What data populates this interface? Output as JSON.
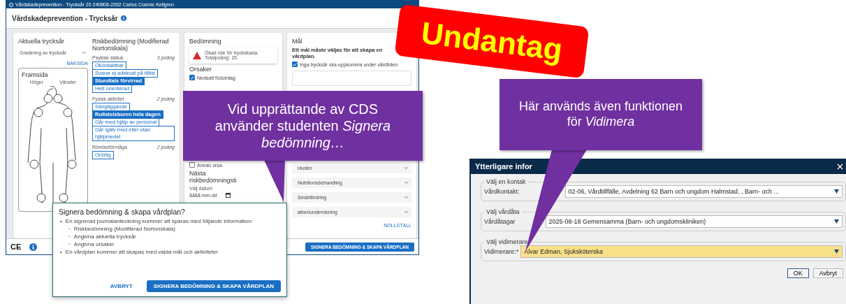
{
  "left_window": {
    "title": "Vårdskadeprevention - Trycksår 20 240806-2392 Carlos Cosmic Kellgren",
    "header": "Vårdskadeprevention - Trycksår",
    "current": {
      "title": "Aktuella trycksår",
      "dropdown": "Gradering av trycksår",
      "link": "BAKSIDA",
      "figure_title": "Framsida",
      "right_label": "Höger",
      "left_label": "Vänster"
    },
    "risk": {
      "title": "Riskbedömning (Modifierad Nortonskala)",
      "groups": [
        {
          "label": "Psykisk status",
          "points": "3 poäng",
          "options": [
            {
              "label": "Okontaktbar",
              "selected": false
            },
            {
              "label": "Svarar ej adekvat på tilltal",
              "selected": false
            },
            {
              "label": "Stundtals förvirrad",
              "selected": true
            },
            {
              "label": "Helt orienterad",
              "selected": false
            }
          ]
        },
        {
          "label": "Fysisk aktivitet",
          "points": "2 poäng",
          "options": [
            {
              "label": "Sängliggande",
              "selected": false
            },
            {
              "label": "Rullstolsburen hela dagen",
              "selected": true
            },
            {
              "label": "Går med hjälp av personal",
              "selected": false
            },
            {
              "label": "Går själv med eller utan hjälpmedel",
              "selected": false
            }
          ]
        },
        {
          "label": "Rörelseförmåga",
          "points": "2 poäng",
          "options": [
            {
              "label": "Orörlig",
              "selected": false
            }
          ]
        }
      ]
    },
    "assessment": {
      "title": "Bedömning",
      "alert_lines": [
        "Ökad risk för tryckskada.",
        "Totalpoäng: 15."
      ],
      "causes_title": "Orsaker",
      "causes": [
        {
          "label": "Nedsatt födointag",
          "checked": true
        },
        {
          "label": "Annan orsa",
          "checked": false
        }
      ],
      "next_title": "Nästa riskbedömningsti",
      "date_label": "Välj datum",
      "date_placeholder": "åååå-mm-dd"
    },
    "goals": {
      "title": "Mål",
      "hint": "Ett mål måste väljas för att skapa en vårdplan.",
      "goals": [
        {
          "label": "Inga trycksår ska uppkomma under vårdtiden",
          "checked": true
        }
      ],
      "activities": [
        "Huden",
        "Nutritionsbehandling",
        "Smärtlindring",
        "ation/undervisning"
      ],
      "reset": "NOLLSTÄLL"
    },
    "ce_mark": "CE",
    "footer_button": "SIGNERA BEDÖMNING & SKAPA VÅRDPLAN"
  },
  "sign_dialog": {
    "title": "Signera bedömning & skapa vårdplan?",
    "items": [
      {
        "bullet": "•",
        "text": "En signerad journalanteckning kommer att sparas med följande information:",
        "children": [
          {
            "bullet": "◦",
            "text": "Riskbedömning (Modifierad Nortonskala)"
          },
          {
            "bullet": "◦",
            "text": "Angivna aktuella trycksår"
          },
          {
            "bullet": "◦",
            "text": "Angivna orsaker"
          }
        ]
      },
      {
        "bullet": "•",
        "text": "En vårdplan kommer att skapas med valda mål och aktiviteter"
      }
    ],
    "cancel": "AVBRYT",
    "confirm": "SIGNERA BEDÖMNING & SKAPA VÅRDPLAN"
  },
  "badge": "Undantag",
  "callouts": [
    "Vid upprättande av CDS använder studenten *Signera bedömning…*",
    "Här används även funktionen för *Vidimera*"
  ],
  "info_dialog": {
    "title": "Ytterligare infor",
    "groups": [
      {
        "legend": "Välj en kontak",
        "label": "Vårdkontakt:",
        "value": "02-06, Vårdtillfälle, Avdelning 62 Barn och ungdom Halmstad, , Barn- och ...",
        "highlighted": false
      },
      {
        "legend": "Välj vårdåta",
        "label": "Vårdåtagar",
        "value": "2025-08-18 Gemensamma (Barn- och ungdomskliniken)",
        "highlighted": false
      },
      {
        "legend": "Välj vidimerare",
        "label": "Vidimerare:*",
        "value": "Alvar Edman, Sjuksköterska",
        "highlighted": true
      }
    ],
    "ok": "OK",
    "cancel": "Avbryt"
  }
}
